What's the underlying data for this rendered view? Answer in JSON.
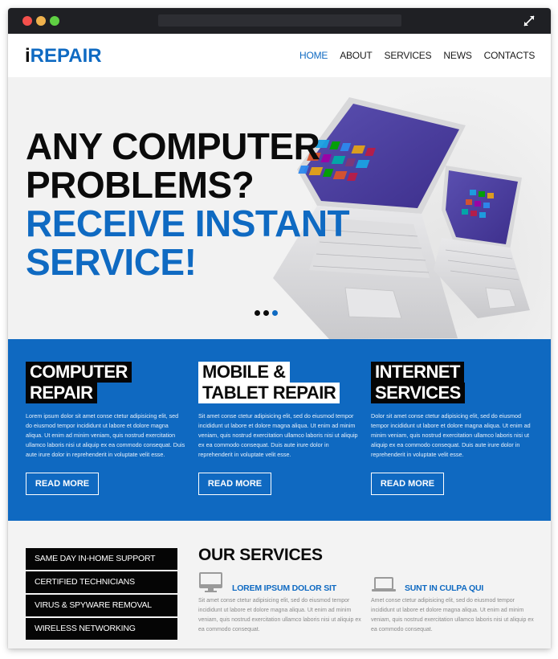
{
  "window": {
    "controls": [
      "close",
      "minimize",
      "maximize"
    ],
    "expand_icon": "expand-arrows-icon"
  },
  "header": {
    "logo_prefix": "i",
    "logo_main": "REPAIR",
    "nav": [
      {
        "label": "HOME",
        "active": true
      },
      {
        "label": "ABOUT",
        "active": false
      },
      {
        "label": "SERVICES",
        "active": false
      },
      {
        "label": "NEWS",
        "active": false
      },
      {
        "label": "CONTACTS",
        "active": false
      }
    ]
  },
  "hero": {
    "line1": "ANY COMPUTER",
    "line2": "PROBLEMS?",
    "line3": "RECEIVE INSTANT",
    "line4": "SERVICE!",
    "slides_total": 3,
    "active_slide": 3,
    "image": "two-laptops-image"
  },
  "features": [
    {
      "title_line1": "COMPUTER",
      "title_line2": "REPAIR",
      "description": "Lorem ipsum dolor sit amet conse ctetur adipisicing elit, sed do eiusmod tempor incididunt ut labore et dolore magna aliqua. Ut enim ad minim veniam, quis nostrud exercitation ullamco laboris nisi ut aliquip ex ea commodo consequat. Duis aute irure dolor in reprehenderit in voluptate velit esse.",
      "button": "READ MORE"
    },
    {
      "title_line1": "MOBILE &",
      "title_line2": "TABLET REPAIR",
      "description": "Sit amet conse ctetur adipisicing elit, sed do eiusmod tempor incididunt ut labore et dolore magna aliqua. Ut enim ad minim veniam, quis nostrud exercitation ullamco laboris nisi ut aliquip ex ea commodo consequat. Duis aute irure dolor in reprehenderit in voluptate velit esse.",
      "button": "READ MORE"
    },
    {
      "title_line1": "INTERNET",
      "title_line2": "SERVICES",
      "description": "Dolor sit amet conse ctetur adipisicing elit, sed do eiusmod tempor incididunt ut labore et dolore magna aliqua. Ut enim ad minim veniam, quis nostrud exercitation ullamco laboris nisi ut aliquip ex ea commodo consequat. Duis aute irure dolor in reprehenderit in voluptate velit esse.",
      "button": "READ MORE"
    }
  ],
  "checklist": [
    "SAME DAY IN-HOME SUPPORT",
    "CERTIFIED TECHNICIANS",
    "VIRUS & SPYWARE REMOVAL",
    "WIRELESS NETWORKING"
  ],
  "our_services": {
    "title": "OUR SERVICES",
    "items": [
      {
        "icon": "desktop-monitor-icon",
        "title": "LOREM IPSUM DOLOR SIT",
        "description": "Sit amet conse ctetur adipisicing elit, sed do eiusmod tempor incididunt ut labore et dolore magna aliqua. Ut enim ad minim veniam, quis nostrud exercitation ullamco laboris nisi ut aliquip ex ea commodo consequat."
      },
      {
        "icon": "laptop-icon",
        "title": "SUNT IN CULPA QUI",
        "description": "Amet conse ctetur adipisicing elit, sed do eiusmod tempor incididunt ut labore et dolore magna aliqua. Ut enim ad minim veniam, quis nostrud exercitation ullamco laboris nisi ut aliquip ex ea commodo consequat."
      }
    ]
  },
  "colors": {
    "brand_blue": "#0f6ac2",
    "band_blue": "#0f69c1",
    "black": "#050505",
    "titlebar": "#1f2024",
    "light_bg": "#f3f3f3"
  }
}
